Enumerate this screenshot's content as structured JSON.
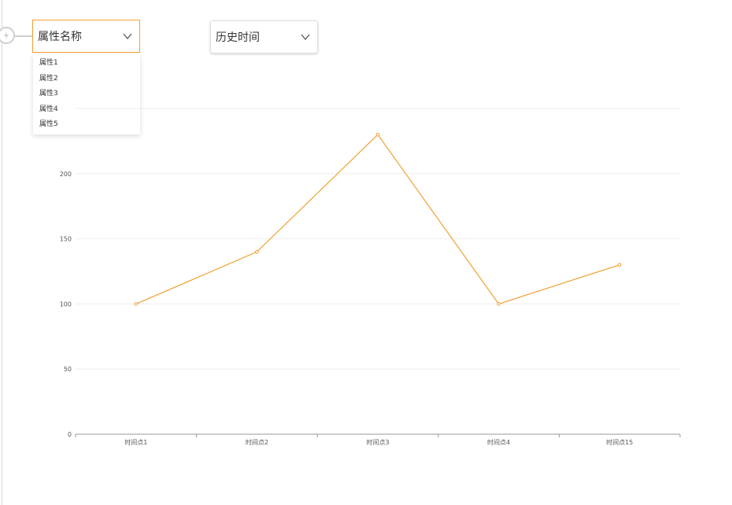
{
  "controls": {
    "attribute_select": {
      "value": "属性名称",
      "options": [
        "属性1",
        "属性2",
        "属性3",
        "属性4",
        "属性5"
      ]
    },
    "time_select": {
      "value": "历史时间"
    }
  },
  "icons": {
    "lightning": "lightning-icon",
    "chevron": "chevron-down-icon"
  },
  "colors": {
    "accent": "#f0a030",
    "line": "#f0a030",
    "axis": "#999999",
    "grid": "#eeeeee"
  },
  "chart_data": {
    "type": "line",
    "categories": [
      "时间点1",
      "时间点2",
      "时间点3",
      "时间点4",
      "时间点15"
    ],
    "series": [
      {
        "values": [
          100,
          140,
          230,
          100,
          130
        ]
      }
    ],
    "yticks": [
      0,
      50,
      100,
      150,
      200
    ],
    "ylim": [
      0,
      250
    ],
    "grid": true,
    "title": "",
    "xlabel": "",
    "ylabel": ""
  }
}
